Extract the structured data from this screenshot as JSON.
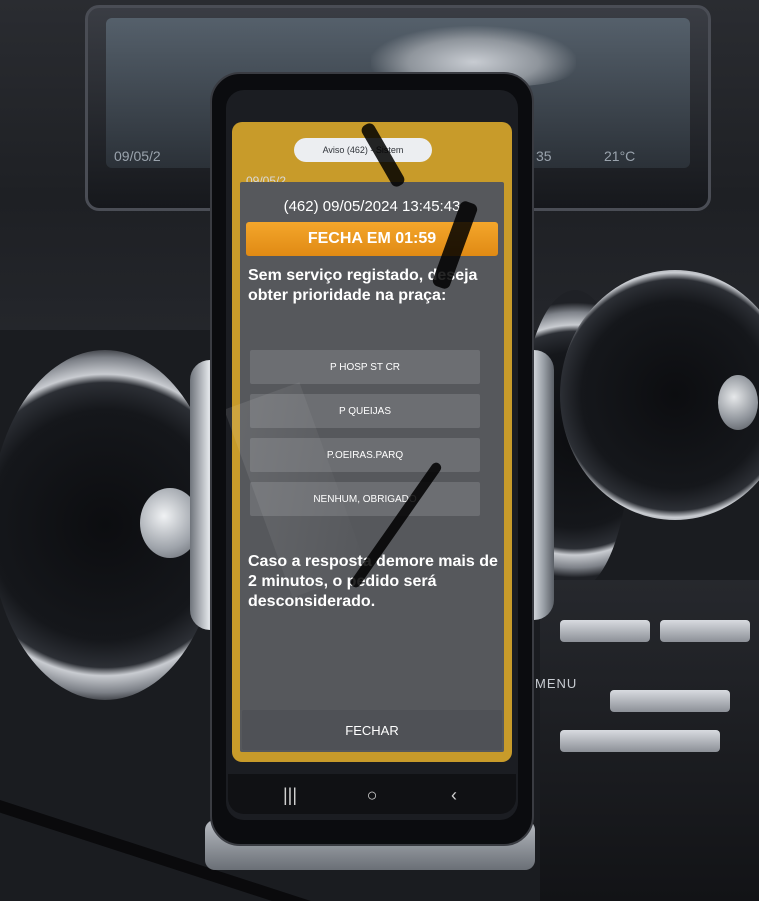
{
  "dashboard": {
    "screen_readout_left": "09/05/2",
    "screen_readout_mid": "35",
    "screen_readout_right": "21°C",
    "menu_label": "MENU"
  },
  "phone": {
    "status_date": "09/05/2",
    "notification_pill": "Aviso (462) - Sistem",
    "app": {
      "message_header": "(462) 09/05/2024 13:45:43",
      "timer_label": "FECHA EM 01:59",
      "prompt": "Sem serviço registado, deseja obter prioridade na praça:",
      "options": [
        {
          "label": "P HOSP ST CR"
        },
        {
          "label": "P QUEIJAS"
        },
        {
          "label": "P.OEIRAS.PARQ"
        },
        {
          "label": "NENHUM, OBRIGADO"
        }
      ],
      "notice": "Caso a resposta demore mais de 2 minutos, o pedido será desconsiderado.",
      "close_label": "FECHAR"
    },
    "navbar": {
      "recents_glyph": "|||",
      "home_glyph": "○",
      "back_glyph": "‹"
    }
  },
  "colors": {
    "timer": "#f09a20",
    "app_frame": "#c89b2a",
    "panel": "#56585c",
    "option": "#6c6e72"
  },
  "icons": [
    "recents-icon",
    "home-icon",
    "back-icon"
  ]
}
